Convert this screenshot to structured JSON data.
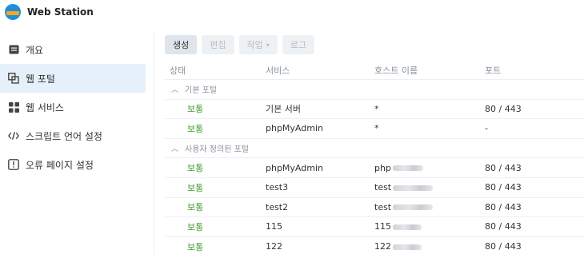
{
  "app": {
    "title": "Web Station"
  },
  "sidebar": {
    "items": [
      {
        "label": "개요",
        "icon": "overview-icon"
      },
      {
        "label": "웹 포털",
        "icon": "web-portal-icon",
        "active": true
      },
      {
        "label": "웹 서비스",
        "icon": "web-service-icon"
      },
      {
        "label": "스크립트 언어 설정",
        "icon": "code-icon"
      },
      {
        "label": "오류 페이지 설정",
        "icon": "error-page-icon"
      }
    ]
  },
  "toolbar": {
    "create": "생성",
    "edit": "편집",
    "action": "작업",
    "log": "로그"
  },
  "table": {
    "headers": [
      "상태",
      "서비스",
      "호스트 이름",
      "포트"
    ],
    "groups": [
      {
        "label": "기본 포털",
        "rows": [
          {
            "status": "보통",
            "service": "기본 서버",
            "host": "*",
            "port": "80 / 443"
          },
          {
            "status": "보통",
            "service": "phpMyAdmin",
            "host": "*",
            "port": "-"
          }
        ]
      },
      {
        "label": "사용자 정의된 포털",
        "rows": [
          {
            "status": "보통",
            "service": "phpMyAdmin",
            "host": "php",
            "port": "80 / 443"
          },
          {
            "status": "보통",
            "service": "test3",
            "host": "test",
            "port": "80 / 443"
          },
          {
            "status": "보통",
            "service": "test2",
            "host": "test",
            "port": "80 / 443"
          },
          {
            "status": "보통",
            "service": "115",
            "host": "115",
            "port": "80 / 443"
          },
          {
            "status": "보통",
            "service": "122",
            "host": "122",
            "port": "80 / 443"
          }
        ]
      }
    ]
  },
  "colors": {
    "status_ok": "#3f9b2c",
    "active_bg": "#e6f0fb",
    "accent": "#1f8fdc"
  }
}
